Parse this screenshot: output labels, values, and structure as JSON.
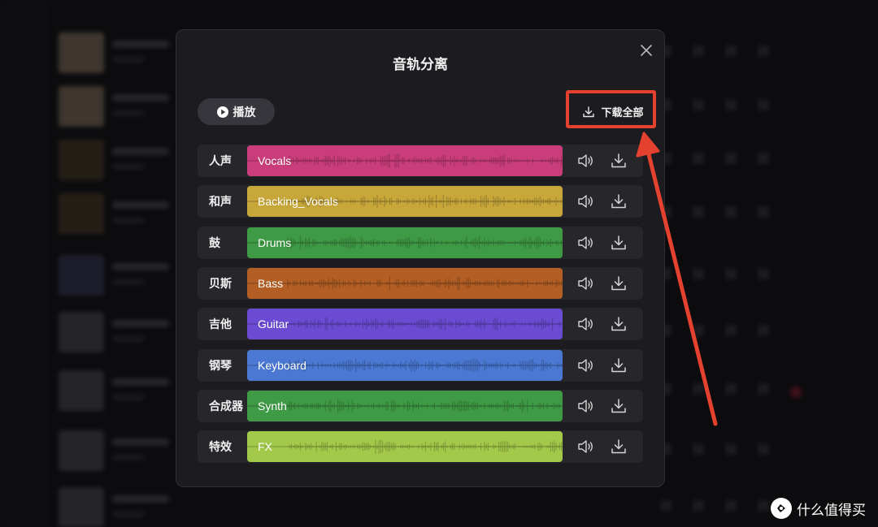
{
  "dialog": {
    "title": "音轨分离",
    "play_label": "播放",
    "download_all_label": "下载全部"
  },
  "tracks": [
    {
      "label": "人声",
      "name": "Vocals",
      "color": "#c93d7a"
    },
    {
      "label": "和声",
      "name": "Backing_Vocals",
      "color": "#c7a63a"
    },
    {
      "label": "鼓",
      "name": "Drums",
      "color": "#3f9a45"
    },
    {
      "label": "贝斯",
      "name": "Bass",
      "color": "#b25e24"
    },
    {
      "label": "吉他",
      "name": "Guitar",
      "color": "#6a4bd1"
    },
    {
      "label": "钢琴",
      "name": "Keyboard",
      "color": "#4a78d2"
    },
    {
      "label": "合成器",
      "name": "Synth",
      "color": "#3f9a45"
    },
    {
      "label": "特效",
      "name": "FX",
      "color": "#a3c94a"
    }
  ],
  "icons": {
    "close": "close-icon",
    "play": "play-icon",
    "download": "download-icon",
    "volume": "volume-icon"
  },
  "annotation": {
    "color": "#e4412e"
  },
  "watermark": {
    "text": "什么值得买"
  }
}
